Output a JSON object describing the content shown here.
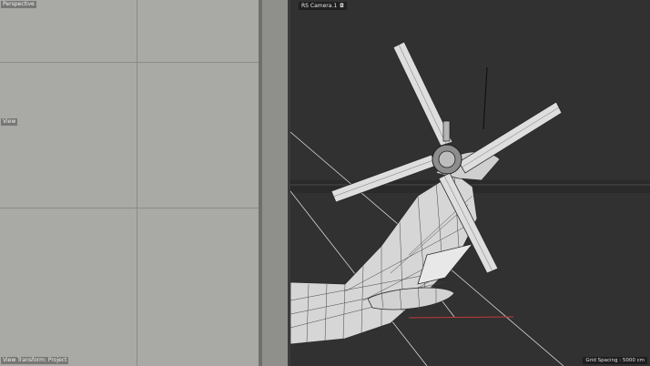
{
  "left_viewport": {
    "top_label": "Perspective",
    "mid_label": "View",
    "bottom_label": "View Transform: Project"
  },
  "right_viewport": {
    "camera_label": "RS Camera.1",
    "camera_icon": "camera-toggle-icon",
    "grid_spacing": "Grid Spacing : 5000 cm"
  },
  "colors": {
    "left_bg": "#a9aaa5",
    "right_bg": "#313131",
    "mesh_fill": "#dcdcdc",
    "mesh_wire": "#2a2a2a",
    "axis_red": "#c23a3a"
  }
}
